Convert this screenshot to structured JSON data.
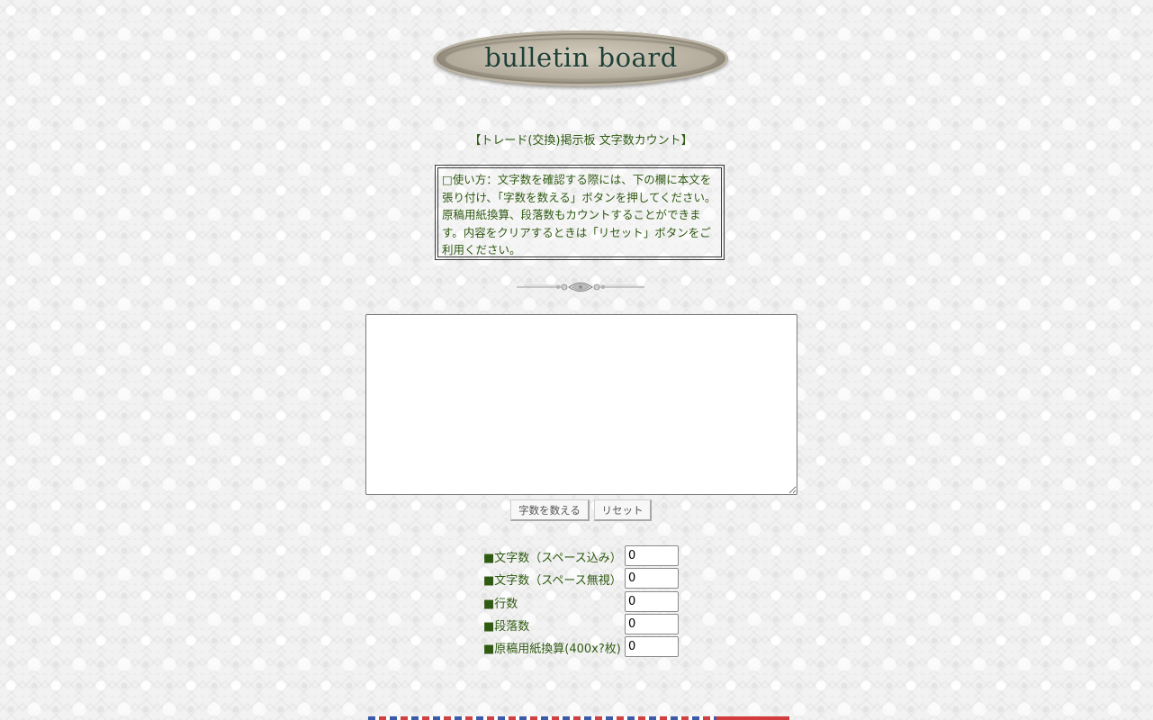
{
  "logo": {
    "text": "bulletin board"
  },
  "page": {
    "title": "【トレード(交換)掲示板 文字数カウント】"
  },
  "instructions": {
    "text": "□使い方：文字数を確認する際には、下の欄に本文を張り付け、「字数を数える」ボタンを押してください。原稿用紙換算、段落数もカウントすることができます。内容をクリアするときは「リセット」ボタンをご利用ください。"
  },
  "editor": {
    "value": ""
  },
  "buttons": {
    "count_label": "字数を数える",
    "reset_label": "リセット"
  },
  "results": [
    {
      "label": "■文字数（スペース込み）",
      "value": "0"
    },
    {
      "label": "■文字数（スペース無視）",
      "value": "0"
    },
    {
      "label": "■行数",
      "value": "0"
    },
    {
      "label": "■段落数",
      "value": "0"
    },
    {
      "label": "■原稿用紙換算(400x?枚)",
      "value": "0"
    }
  ],
  "colors": {
    "text_green": "#2f5a12",
    "logo_text": "#1f4037"
  }
}
